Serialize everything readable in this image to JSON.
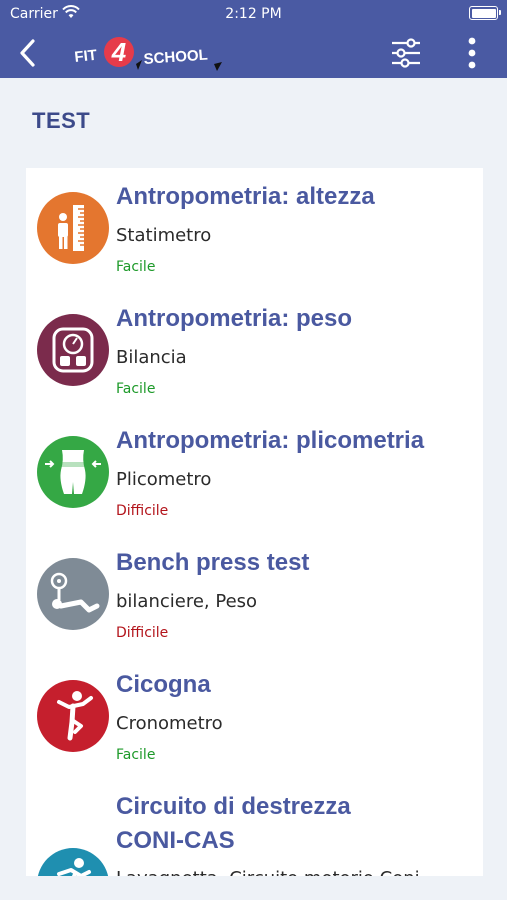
{
  "status_bar": {
    "carrier": "Carrier",
    "time": "2:12 PM"
  },
  "nav": {
    "logo": {
      "part1": "FIT",
      "digit": "4",
      "part2": "SCHOOL"
    },
    "back_icon": "chevron-left-icon",
    "filter_icon": "sliders-icon",
    "more_icon": "vertical-dots-icon"
  },
  "section_title": "TEST",
  "colors": {
    "header": "#4a5aa3",
    "title": "#4a59a0",
    "easy": "#1e9a2a",
    "hard": "#b3141b",
    "logo_red": "#e63b4a"
  },
  "tests": [
    {
      "name": "Antropometria: altezza",
      "equipment": "Statimetro",
      "level": "Facile",
      "icon": "height-measure-icon",
      "icon_color": "#e4762f"
    },
    {
      "name": "Antropometria: peso",
      "equipment": "Bilancia",
      "level": "Facile",
      "icon": "scale-icon",
      "icon_color": "#7b2b4c"
    },
    {
      "name": "Antropometria: plicometria",
      "equipment": "Plicometro",
      "level": "Difficile",
      "icon": "body-measure-icon",
      "icon_color": "#35a845"
    },
    {
      "name": "Bench press test",
      "equipment": "bilanciere, Peso",
      "level": "Difficile",
      "icon": "bench-press-icon",
      "icon_color": "#7f8b96"
    },
    {
      "name": "Cicogna",
      "equipment": "Cronometro",
      "level": "Facile",
      "icon": "balance-pose-icon",
      "icon_color": "#c51f2d"
    },
    {
      "name_line1": "Circuito di destrezza",
      "name_line2": "CONI-CAS",
      "equipment": "Lavagnetta, Circuito motorio Coni",
      "icon": "runner-icon",
      "icon_color": "#1f8fb0"
    }
  ]
}
